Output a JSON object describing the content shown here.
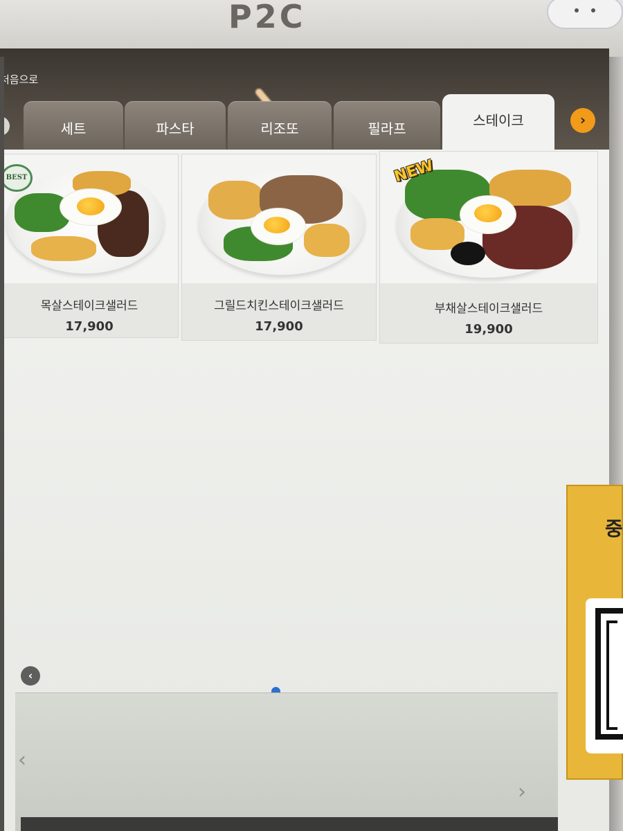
{
  "device": {
    "brand": "P2C"
  },
  "header": {
    "back_home": "처음으로"
  },
  "tabs": [
    {
      "label": "세트",
      "active": false
    },
    {
      "label": "파스타",
      "active": false
    },
    {
      "label": "리조또",
      "active": false
    },
    {
      "label": "필라프",
      "active": false
    },
    {
      "label": "스테이크",
      "active": true
    }
  ],
  "menu_items": [
    {
      "name": "목살스테이크샐러드",
      "price": "17,900",
      "badge": "BEST"
    },
    {
      "name": "그릴드치킨스테이크샐러드",
      "price": "17,900",
      "badge": ""
    },
    {
      "name": "부채살스테이크샐러드",
      "price": "19,900",
      "badge": "NEW"
    }
  ],
  "pagination": {
    "current_page": 1,
    "total_pages": 1
  },
  "sticker": {
    "text": "중"
  },
  "colors": {
    "accent": "#f29a1a",
    "page_dot": "#2d6fcf",
    "header": "#514a42",
    "active_tab": "#f2f2f0",
    "sticker": "#e8b73a"
  },
  "icons": {
    "tab_next": "chevron-right-icon",
    "tab_prev": "chevron-left-icon",
    "page_prev": "chevron-left-icon",
    "page_next": "chevron-right-icon"
  }
}
